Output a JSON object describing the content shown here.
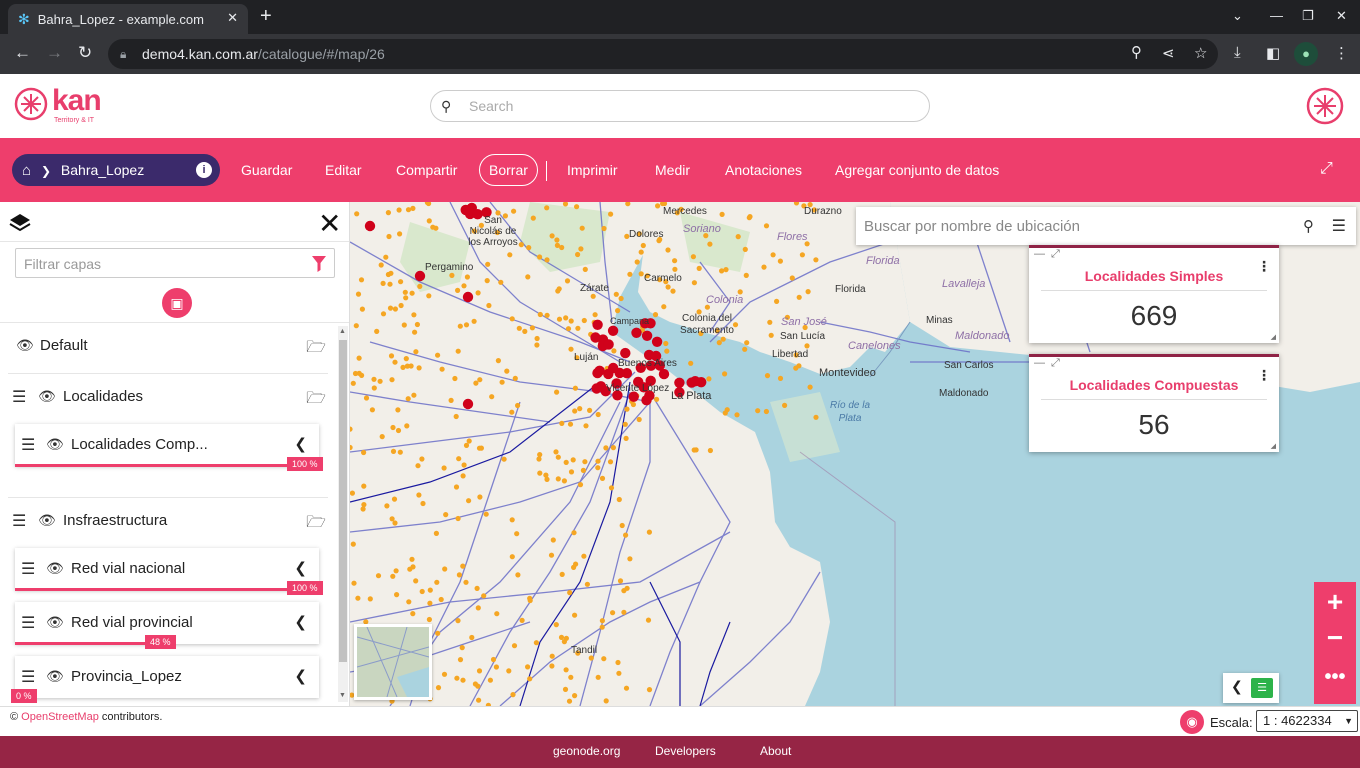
{
  "browser": {
    "tab_title": "Bahra_Lopez - example.com",
    "url_host": "demo4.kan.com.ar",
    "url_path": "/catalogue/#/map/26"
  },
  "header": {
    "logo_text": "kan",
    "logo_sub": "Territory & IT",
    "search_placeholder": "Search"
  },
  "toolbar": {
    "breadcrumb": "Bahra_Lopez",
    "buttons": [
      "Guardar",
      "Editar",
      "Compartir",
      "Borrar",
      "Imprimir",
      "Medir",
      "Anotaciones",
      "Agregar conjunto de datos"
    ]
  },
  "sidebar": {
    "filter_placeholder": "Filtrar capas",
    "groups": [
      {
        "name": "Default"
      },
      {
        "name": "Localidades"
      },
      {
        "name": "Insfraestructura"
      }
    ],
    "layers": [
      {
        "name": "Localidades Comp...",
        "opacity": 1.0,
        "opacity_label": "100 %"
      },
      {
        "name": "Red vial nacional",
        "opacity": 1.0,
        "opacity_label": "100 %"
      },
      {
        "name": "Red vial provincial",
        "opacity": 0.48,
        "opacity_label": "48 %"
      },
      {
        "name": "Provincia_Lopez",
        "opacity": 0.0,
        "opacity_label": "0 %"
      }
    ]
  },
  "map": {
    "search_placeholder": "Buscar por nombre de ubicación",
    "labels": [
      "Mercedes",
      "Durazno",
      "San Nicolás de los Arroyos",
      "Dolores",
      "Soriano",
      "Flores",
      "Florida",
      "Pergamino",
      "Carmelo",
      "Zárate",
      "Colonia",
      "Florida",
      "Lavalleja",
      "Colonia del Sacramento",
      "San José",
      "Minas",
      "Maldonado",
      "Campana",
      "San Lucía",
      "Canelones",
      "Luján",
      "Libertad",
      "Buenos Aires",
      "Montevideo",
      "San Carlos",
      "Maldonado",
      "Vicente López",
      "La Plata",
      "Río de la Plata",
      "Tandil"
    ],
    "widgets": [
      {
        "title": "Localidades Simples",
        "value": "669"
      },
      {
        "title": "Localidades Compuestas",
        "value": "56"
      }
    ]
  },
  "footer": {
    "attribution_prefix": "©",
    "attribution_link": "OpenStreetMap",
    "attribution_suffix": "contributors.",
    "scale_label": "Escala:",
    "scale_value": "1 : 4622334",
    "links": [
      "geonode.org",
      "Developers",
      "About"
    ]
  },
  "colors": {
    "accent": "#ee3e6c",
    "breadcrumb_bg": "#3b2a6b",
    "footer_bg": "#962545",
    "water": "#aad3df",
    "land": "#f2efe9",
    "point_simple": "#f5a623",
    "point_compound": "#d0021b"
  }
}
